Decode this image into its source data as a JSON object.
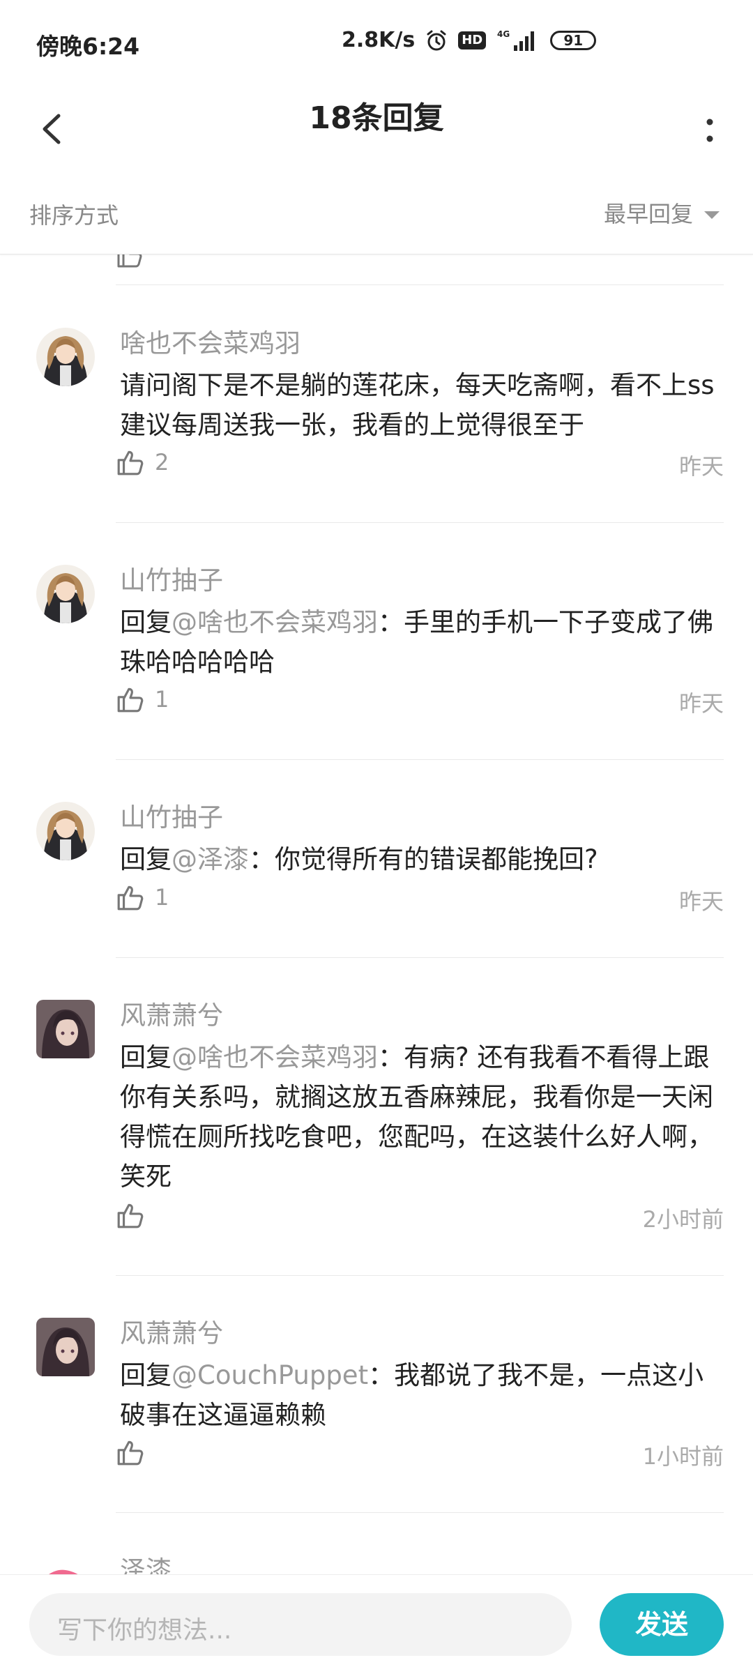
{
  "status_bar": {
    "time": "傍晚6:24",
    "net_speed": "2.8K/s",
    "hd": "HD",
    "network": "4G",
    "battery": "91"
  },
  "header": {
    "title": "18条回复"
  },
  "sort_bar": {
    "label": "排序方式",
    "selected": "最早回复"
  },
  "comments": [
    {
      "username": "啥也不会菜鸡羽",
      "prefix": "",
      "mention": "",
      "text": "请问阁下是不是躺的莲花床，每天吃斋啊，看不上ss建议每周送我一张，我看的上觉得很至于",
      "likes": "2",
      "time": "昨天",
      "avatar": "brown-hair-anime-avatar"
    },
    {
      "username": "山竹抽子",
      "prefix": "回复",
      "mention": "@啥也不会菜鸡羽",
      "text": "：手里的手机一下子变成了佛珠哈哈哈哈哈",
      "likes": "1",
      "time": "昨天",
      "avatar": "brown-hair-anime-avatar"
    },
    {
      "username": "山竹抽子",
      "prefix": "回复",
      "mention": "@泽漆",
      "text": "：你觉得所有的错误都能挽回?",
      "likes": "1",
      "time": "昨天",
      "avatar": "brown-hair-anime-avatar"
    },
    {
      "username": "风萧萧兮",
      "prefix": "回复",
      "mention": "@啥也不会菜鸡羽",
      "text": "：有病? 还有我看不看得上跟你有关系吗，就搁这放五香麻辣屁，我看你是一天闲得慌在厕所找吃食吧，您配吗，在这装什么好人啊，笑死",
      "likes": "",
      "time": "2小时前",
      "avatar": "dark-hair-anime-avatar"
    },
    {
      "username": "风萧萧兮",
      "prefix": "回复",
      "mention": "@CouchPuppet",
      "text": "：我都说了我不是，一点这小破事在这逼逼赖赖",
      "likes": "",
      "time": "1小时前",
      "avatar": "dark-hair-anime-avatar"
    },
    {
      "username": "泽漆",
      "avatar": "pink-hair-anime-avatar"
    }
  ],
  "input_bar": {
    "placeholder": "写下你的想法...",
    "send_label": "发送"
  },
  "colors": {
    "accent": "#20b7c6",
    "muted_text": "#999999",
    "body_text": "#222222"
  }
}
